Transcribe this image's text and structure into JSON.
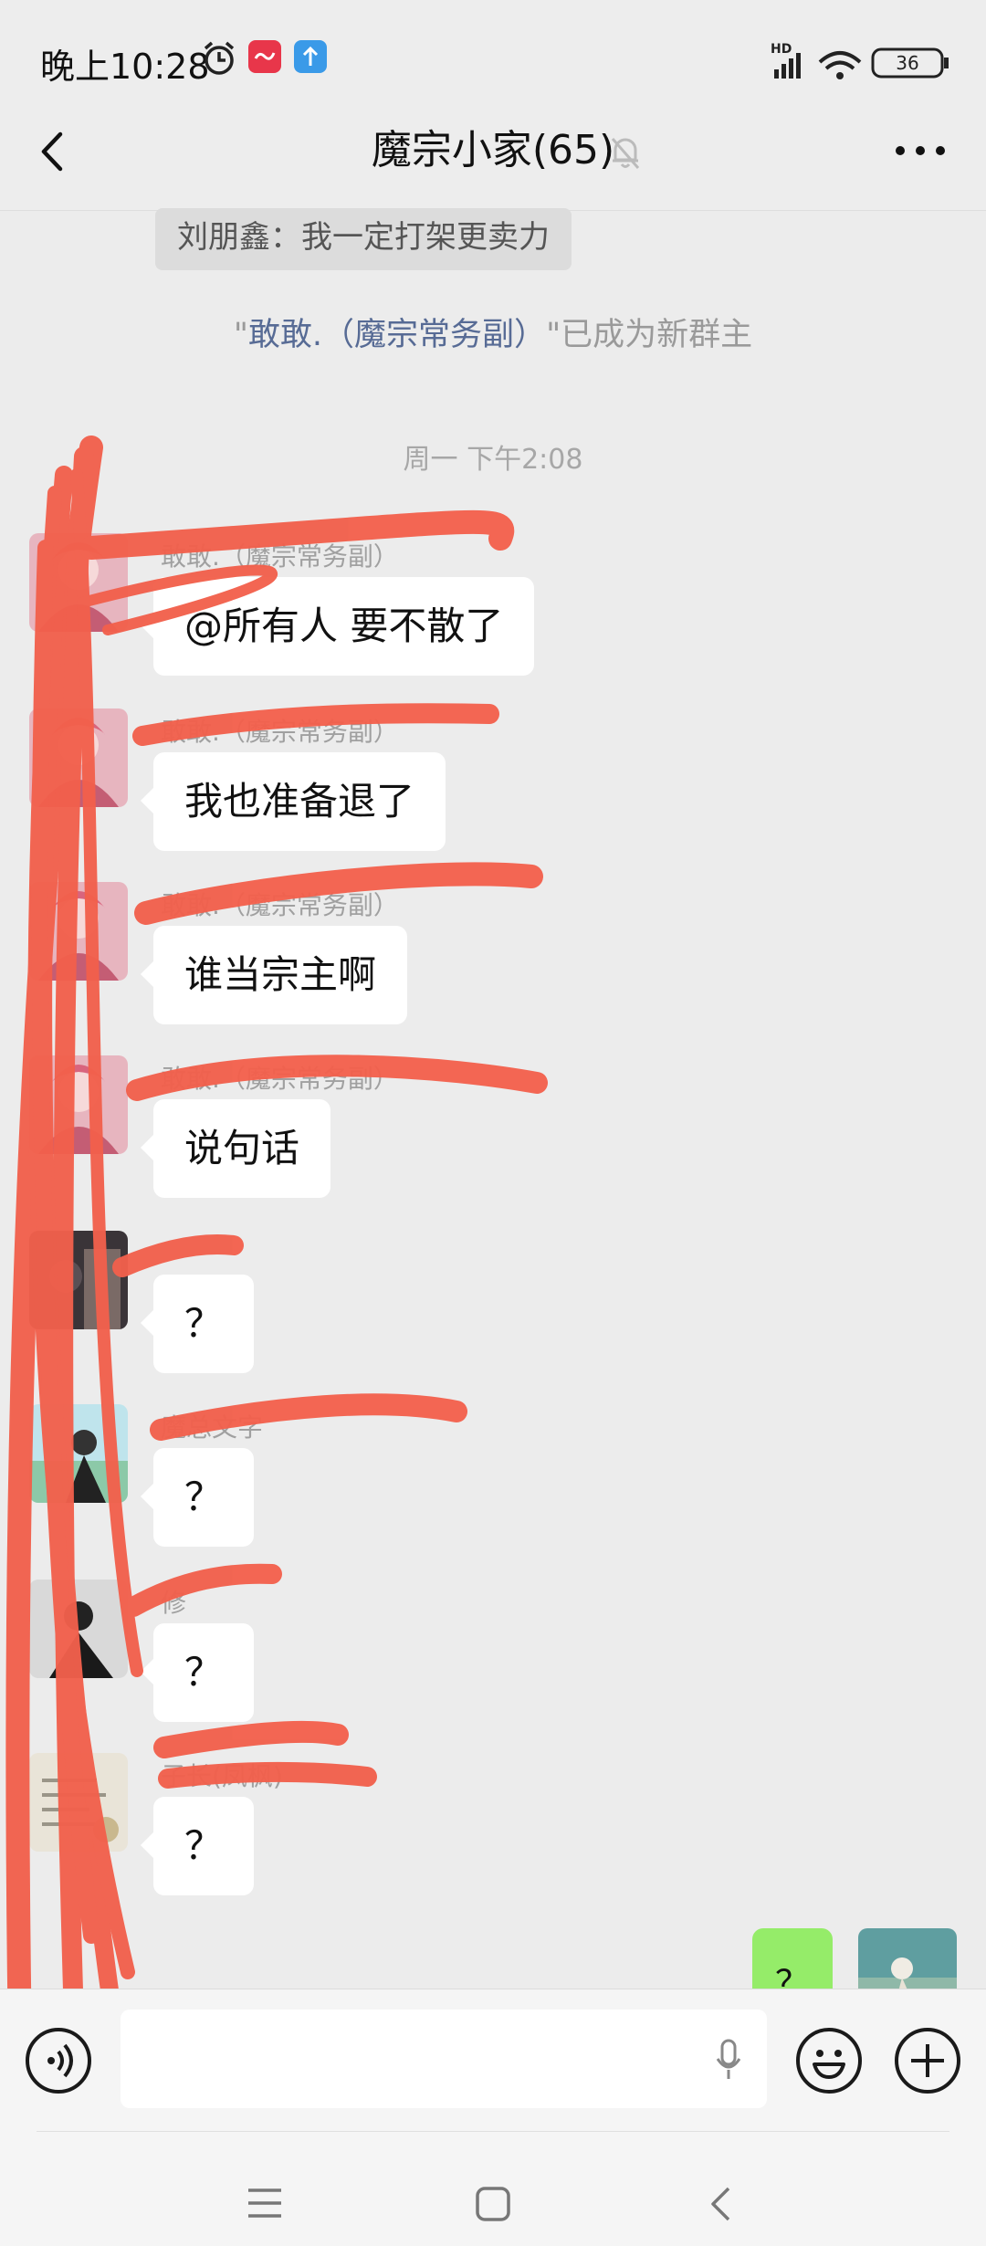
{
  "status_bar": {
    "time": "晚上10:28",
    "battery": "36",
    "network": "HD"
  },
  "header": {
    "title": "魔宗小家(65)"
  },
  "chat": {
    "system_pill": "刘朋鑫：我一定打架更卖力",
    "owner_change": {
      "q1": "\"",
      "name": "敢敢.（魔宗常务副）",
      "q2": "\"",
      "suffix": "已成为新群主"
    },
    "timestamp": "周一 下午2:08",
    "messages": [
      {
        "sender": "敢敢.（魔宗常务副）",
        "text": "@所有人  要不散了",
        "avatar": "pink"
      },
      {
        "sender": "敢敢.（魔宗常务副）",
        "text": "我也准备退了",
        "avatar": "pink"
      },
      {
        "sender": "敢敢.（魔宗常务副）",
        "text": "谁当宗主啊",
        "avatar": "pink"
      },
      {
        "sender": "敢敢.（魔宗常务副）",
        "text": "说句话",
        "avatar": "pink"
      },
      {
        "sender": "",
        "text": "？",
        "avatar": "dark"
      },
      {
        "sender": "魔总文字",
        "text": "？",
        "avatar": "sky"
      },
      {
        "sender": "修",
        "text": "？",
        "avatar": "gray"
      },
      {
        "sender": "子长(凤枫)",
        "text": "？",
        "avatar": "paper"
      }
    ],
    "my_message": {
      "text": "？"
    }
  },
  "colors": {
    "bubble_self": "#95ec69",
    "system_link": "#576b95",
    "scribble": "#f2604c"
  }
}
